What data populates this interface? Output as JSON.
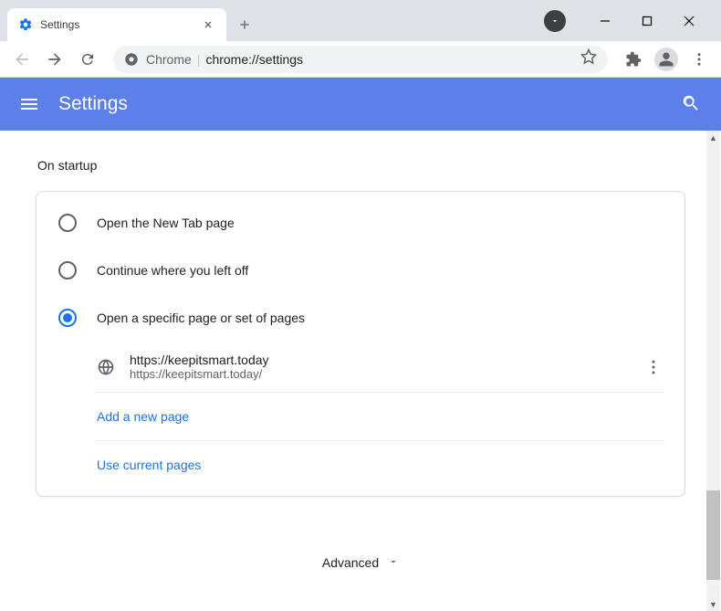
{
  "window": {
    "tab_title": "Settings"
  },
  "omnibox": {
    "prefix": "Chrome",
    "path": "chrome://settings"
  },
  "header": {
    "title": "Settings"
  },
  "section": {
    "title": "On startup",
    "options": [
      {
        "label": "Open the New Tab page"
      },
      {
        "label": "Continue where you left off"
      },
      {
        "label": "Open a specific page or set of pages"
      }
    ],
    "page_entry": {
      "title": "https://keepitsmart.today",
      "url": "https://keepitsmart.today/"
    },
    "add_page": "Add a new page",
    "use_current": "Use current pages"
  },
  "advanced": "Advanced"
}
